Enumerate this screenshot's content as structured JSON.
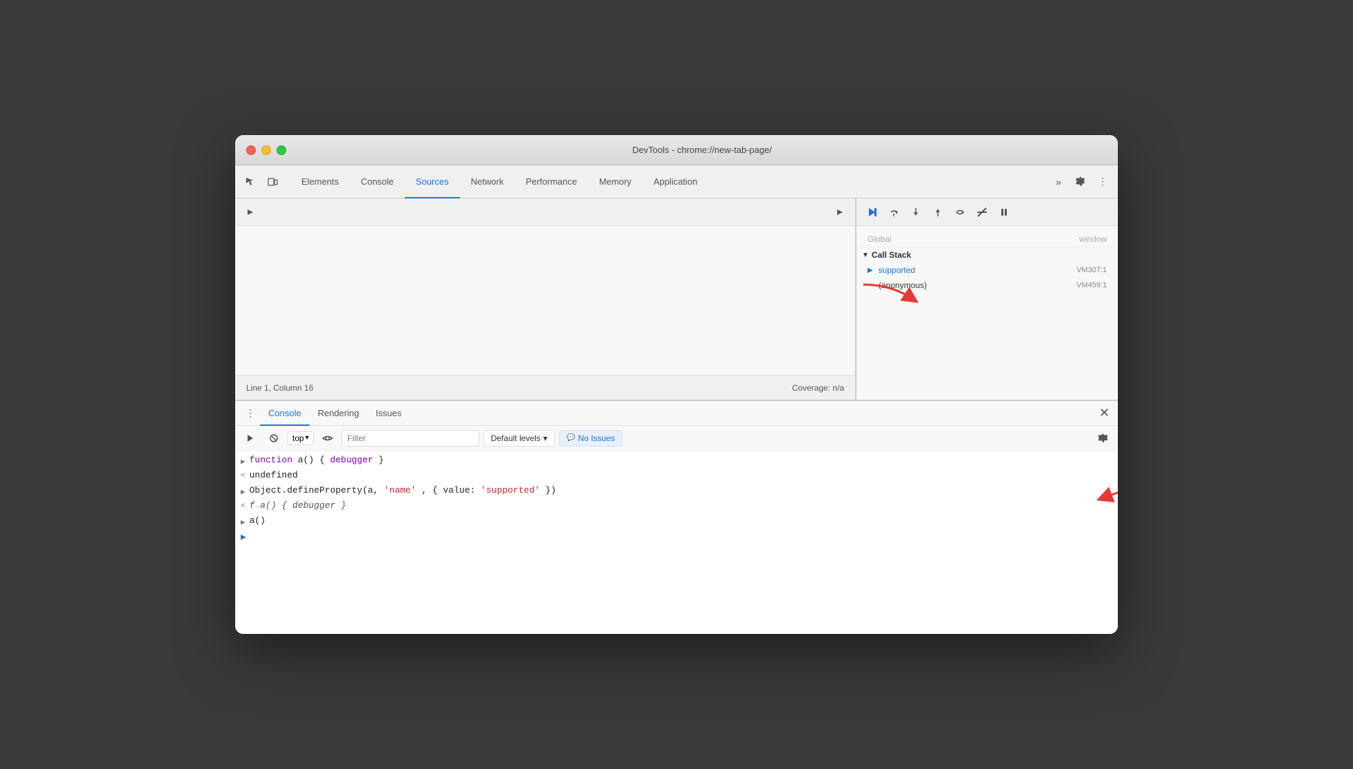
{
  "window": {
    "title": "DevTools - chrome://new-tab-page/"
  },
  "tabs": {
    "items": [
      {
        "label": "Elements",
        "active": false
      },
      {
        "label": "Console",
        "active": false
      },
      {
        "label": "Sources",
        "active": true
      },
      {
        "label": "Network",
        "active": false
      },
      {
        "label": "Performance",
        "active": false
      },
      {
        "label": "Memory",
        "active": false
      },
      {
        "label": "Application",
        "active": false
      }
    ]
  },
  "status_bar": {
    "left": "Line 1, Column 16",
    "right": "Coverage: n/a"
  },
  "call_stack": {
    "header": "Call Stack",
    "items": [
      {
        "name": "supported",
        "location": "VM307:1",
        "active": true
      },
      {
        "name": "(anonymous)",
        "location": "VM459:1",
        "active": false
      }
    ],
    "partial_top": "Global"
  },
  "console": {
    "tabs": [
      "Console",
      "Rendering",
      "Issues"
    ],
    "active_tab": "Console",
    "toolbar": {
      "context": "top",
      "filter_placeholder": "Filter",
      "levels_label": "Default levels",
      "no_issues_label": "No Issues"
    },
    "lines": [
      {
        "type": "input",
        "arrow": ">",
        "content_parts": [
          {
            "text": "function",
            "class": "code-purple"
          },
          {
            "text": " a() { ",
            "class": "code-black"
          },
          {
            "text": "debugger",
            "class": "code-purple"
          },
          {
            "text": " }",
            "class": "code-black"
          }
        ]
      },
      {
        "type": "output",
        "arrow": "<",
        "content_parts": [
          {
            "text": "undefined",
            "class": "code-black"
          }
        ]
      },
      {
        "type": "input",
        "arrow": ">",
        "content_parts": [
          {
            "text": "Object.defineProperty(a, ",
            "class": "code-black"
          },
          {
            "text": "'name'",
            "class": "code-red"
          },
          {
            "text": ", { value: ",
            "class": "code-black"
          },
          {
            "text": "'supported'",
            "class": "code-red"
          },
          {
            "text": " })",
            "class": "code-black"
          }
        ]
      },
      {
        "type": "output",
        "arrow": "<",
        "content_parts": [
          {
            "text": "f",
            "class": "code-gray"
          },
          {
            "text": " a() { ",
            "class": "code-gray"
          },
          {
            "text": "debugger",
            "class": "code-gray"
          },
          {
            "text": " }",
            "class": "code-gray"
          }
        ]
      },
      {
        "type": "input",
        "arrow": ">",
        "content_parts": [
          {
            "text": "a()",
            "class": "code-black"
          }
        ]
      }
    ]
  },
  "icons": {
    "cursor": "⬚",
    "layers": "❐",
    "more": "»",
    "settings": "⚙",
    "ellipsis": "⋮",
    "play": "▶",
    "pause_play": "▶▐",
    "step_over": "↷",
    "step_into": "↓",
    "step_out": "↑",
    "deactivate": "⊘",
    "pause": "⏸",
    "ban": "🚫",
    "chevron_down": "▾",
    "eye": "👁",
    "close": "✕",
    "gear": "⚙",
    "chat": "💬",
    "resume": "▶",
    "panel_expand": "▶",
    "sources_expand": "▶",
    "left_right_arrows": "⇄"
  }
}
